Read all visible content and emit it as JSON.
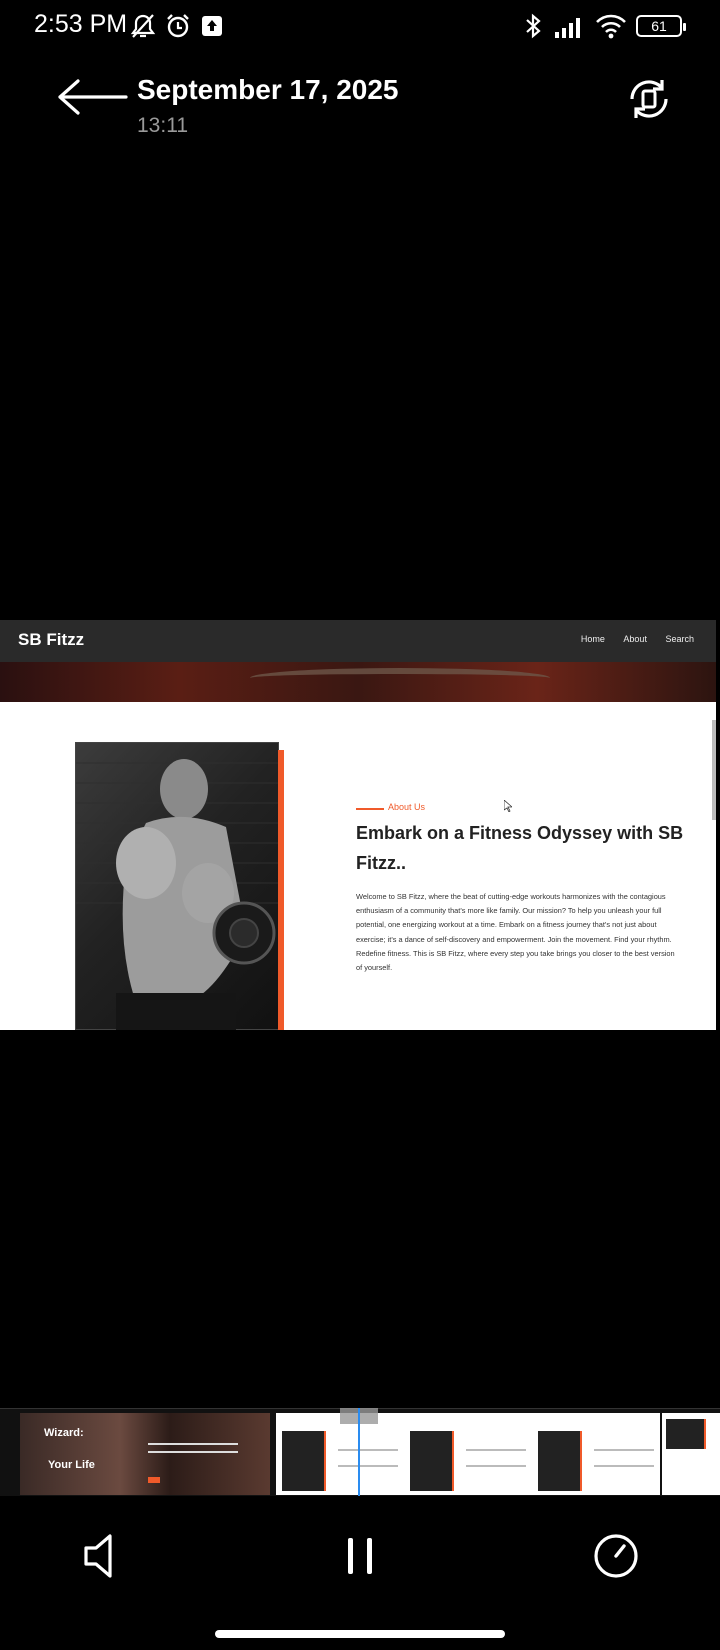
{
  "status_bar": {
    "time": "2:53 PM",
    "battery": "61",
    "icons": [
      "mute-icon",
      "alarm-icon",
      "upload-icon",
      "bluetooth-icon",
      "signal-icon",
      "wifi-icon",
      "battery-icon"
    ]
  },
  "header": {
    "date": "September 17, 2025",
    "time": "13:11"
  },
  "video": {
    "site": {
      "logo": "SB Fitzz",
      "nav": [
        "Home",
        "About",
        "Search"
      ]
    },
    "about": {
      "kicker": "About Us",
      "heading": "Embark on a Fitness Odyssey with SB Fitzz..",
      "body": "Welcome to SB Fitzz, where the beat of cutting-edge workouts harmonizes with the contagious enthusiasm of a community that's more like family. Our mission? To help you unleash your full potential, one energizing workout at a time. Embark on a fitness journey that's not just about exercise; it's a dance of self-discovery and empowerment. Join the movement. Find your rhythm. Redefine fitness. This is SB Fitzz, where every step you take brings you closer to the best version of yourself."
    }
  },
  "timeline": {
    "thumb_text_1": "Wizard:",
    "thumb_text_2": "Your Life"
  },
  "colors": {
    "accent": "#f05a2a",
    "playhead": "#2a8cf0",
    "background": "#000000"
  }
}
